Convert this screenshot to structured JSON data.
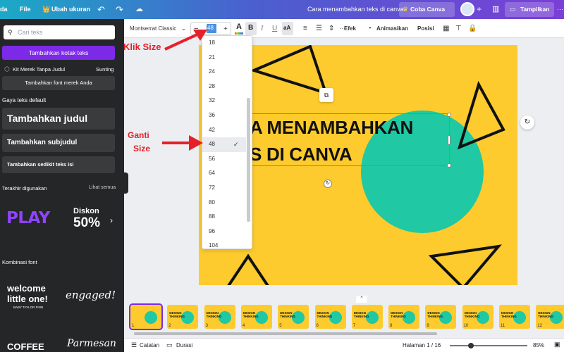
{
  "topbar": {
    "home": "da",
    "file": "File",
    "resize": "Ubah ukuran",
    "doc_title": "Cara menambahkan teks di canva",
    "pro": "Coba Canva Pro",
    "share": "Tampilkan"
  },
  "sidebar": {
    "search_placeholder": "Cari teks",
    "add_textbox": "Tambahkan kotak teks",
    "brand_kit": "Kit Merek Tanpa Judul",
    "brand_edit": "Sunting",
    "brand_font": "Tambahkan font merek Anda",
    "default_styles_label": "Gaya teks default",
    "heading": "Tambahkan judul",
    "subheading": "Tambahkan subjudul",
    "body": "Tambahkan sedikit teks isi",
    "recent_label": "Terakhir digunakan",
    "see_all": "Lihat semua",
    "recent_1": "PLAY",
    "recent_2_small": "Diskon",
    "recent_2_big": "50%",
    "combos_label": "Kombinasi font",
    "combo_1a": "welcome",
    "combo_1b": "little one!",
    "combo_1c": "BABY TAYLOR FINN",
    "combo_2": "engaged!",
    "combo_3": "COFFEE",
    "combo_4": "Parmesan"
  },
  "toolbar": {
    "font": "Montserrat Classic",
    "minus": "−",
    "size": "48",
    "plus": "+",
    "color_letter": "A",
    "bold": "B",
    "italic": "I",
    "underline": "U",
    "case": "aA",
    "effects": "Efek",
    "animate": "Animasikan",
    "position": "Posisi"
  },
  "dropdown": {
    "options": [
      "18",
      "21",
      "24",
      "28",
      "32",
      "36",
      "42",
      "48",
      "56",
      "64",
      "72",
      "80",
      "88",
      "96",
      "104"
    ],
    "selected": "48",
    "check": "✓"
  },
  "slide": {
    "line1": "A MENAMBAHKAN",
    "line2": "S DI CANVA"
  },
  "annotations": {
    "klik_size": "Klik Size",
    "ganti": "Ganti",
    "size": "Size"
  },
  "thumbs": {
    "numbers": [
      "1",
      "2",
      "3",
      "4",
      "5",
      "6",
      "7",
      "8",
      "9",
      "10",
      "11",
      "12"
    ],
    "label": "DESIGN THINKING"
  },
  "bottombar": {
    "notes": "Catatan",
    "duration": "Durasi",
    "page": "Halaman 1 / 16",
    "zoom": "85%"
  },
  "colors": {
    "brand_purple": "#7d2ae8",
    "slide_yellow": "#fdcb2e",
    "circle_teal": "#20c8a3",
    "annotation_red": "#e6202a"
  }
}
